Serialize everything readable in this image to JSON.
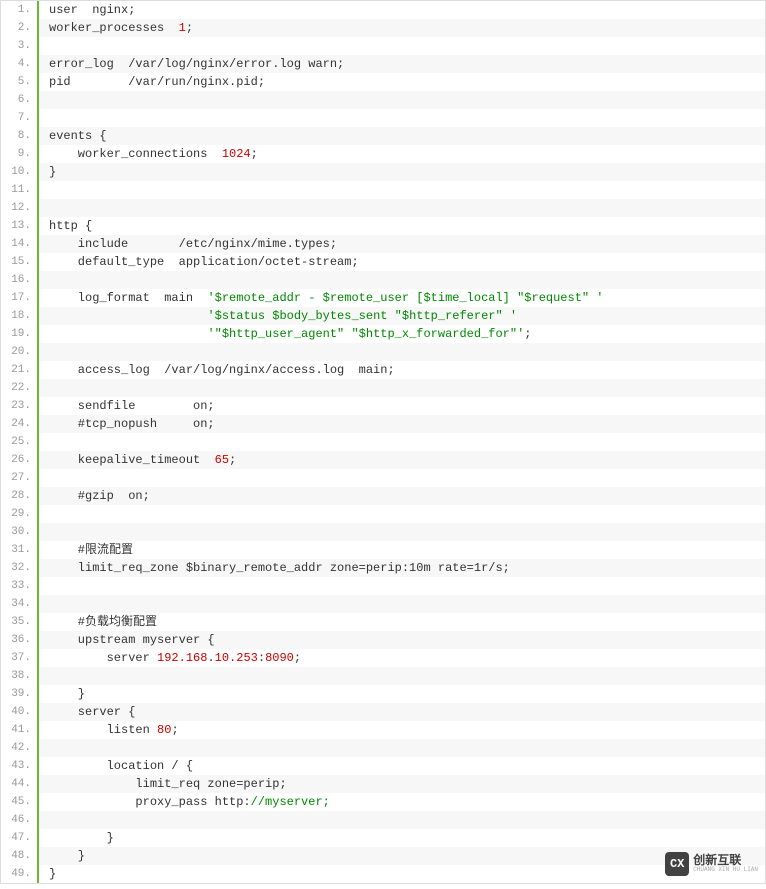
{
  "lines": [
    {
      "n": "1.",
      "segments": [
        {
          "t": "user  nginx;",
          "c": ""
        }
      ]
    },
    {
      "n": "2.",
      "segments": [
        {
          "t": "worker_processes  ",
          "c": ""
        },
        {
          "t": "1",
          "c": "num"
        },
        {
          "t": ";",
          "c": ""
        }
      ]
    },
    {
      "n": "3.",
      "segments": [
        {
          "t": "",
          "c": ""
        }
      ]
    },
    {
      "n": "4.",
      "segments": [
        {
          "t": "error_log  /var/log/nginx/error.log warn;",
          "c": ""
        }
      ]
    },
    {
      "n": "5.",
      "segments": [
        {
          "t": "pid        /var/run/nginx.pid;",
          "c": ""
        }
      ]
    },
    {
      "n": "6.",
      "segments": [
        {
          "t": "",
          "c": ""
        }
      ]
    },
    {
      "n": "7.",
      "segments": [
        {
          "t": "",
          "c": ""
        }
      ]
    },
    {
      "n": "8.",
      "segments": [
        {
          "t": "events {",
          "c": ""
        }
      ]
    },
    {
      "n": "9.",
      "segments": [
        {
          "t": "    worker_connections  ",
          "c": ""
        },
        {
          "t": "1024",
          "c": "num"
        },
        {
          "t": ";",
          "c": ""
        }
      ]
    },
    {
      "n": "10.",
      "segments": [
        {
          "t": "}",
          "c": ""
        }
      ]
    },
    {
      "n": "11.",
      "segments": [
        {
          "t": "",
          "c": ""
        }
      ]
    },
    {
      "n": "12.",
      "segments": [
        {
          "t": "",
          "c": ""
        }
      ]
    },
    {
      "n": "13.",
      "segments": [
        {
          "t": "http {",
          "c": ""
        }
      ]
    },
    {
      "n": "14.",
      "segments": [
        {
          "t": "    include       /etc/nginx/mime.types;",
          "c": ""
        }
      ]
    },
    {
      "n": "15.",
      "segments": [
        {
          "t": "    default_type  application/octet-stream;",
          "c": ""
        }
      ]
    },
    {
      "n": "16.",
      "segments": [
        {
          "t": "",
          "c": ""
        }
      ]
    },
    {
      "n": "17.",
      "segments": [
        {
          "t": "    log_format  main  ",
          "c": ""
        },
        {
          "t": "'$remote_addr - $remote_user [$time_local] \"$request\" '",
          "c": "str"
        }
      ]
    },
    {
      "n": "18.",
      "segments": [
        {
          "t": "                      ",
          "c": ""
        },
        {
          "t": "'$status $body_bytes_sent \"$http_referer\" '",
          "c": "str"
        }
      ]
    },
    {
      "n": "19.",
      "segments": [
        {
          "t": "                      ",
          "c": ""
        },
        {
          "t": "'\"$http_user_agent\" \"$http_x_forwarded_for\"'",
          "c": "str"
        },
        {
          "t": ";",
          "c": ""
        }
      ]
    },
    {
      "n": "20.",
      "segments": [
        {
          "t": "",
          "c": ""
        }
      ]
    },
    {
      "n": "21.",
      "segments": [
        {
          "t": "    access_log  /var/log/nginx/access.log  main;",
          "c": ""
        }
      ]
    },
    {
      "n": "22.",
      "segments": [
        {
          "t": "",
          "c": ""
        }
      ]
    },
    {
      "n": "23.",
      "segments": [
        {
          "t": "    sendfile        on;",
          "c": ""
        }
      ]
    },
    {
      "n": "24.",
      "segments": [
        {
          "t": "    #tcp_nopush     on;",
          "c": ""
        }
      ]
    },
    {
      "n": "25.",
      "segments": [
        {
          "t": "",
          "c": ""
        }
      ]
    },
    {
      "n": "26.",
      "segments": [
        {
          "t": "    keepalive_timeout  ",
          "c": ""
        },
        {
          "t": "65",
          "c": "num"
        },
        {
          "t": ";",
          "c": ""
        }
      ]
    },
    {
      "n": "27.",
      "segments": [
        {
          "t": "",
          "c": ""
        }
      ]
    },
    {
      "n": "28.",
      "segments": [
        {
          "t": "    #gzip  on;",
          "c": ""
        }
      ]
    },
    {
      "n": "29.",
      "segments": [
        {
          "t": "",
          "c": ""
        }
      ]
    },
    {
      "n": "30.",
      "segments": [
        {
          "t": "",
          "c": ""
        }
      ]
    },
    {
      "n": "31.",
      "segments": [
        {
          "t": "    #限流配置",
          "c": ""
        }
      ]
    },
    {
      "n": "32.",
      "segments": [
        {
          "t": "    limit_req_zone $binary_remote_addr zone=perip:10m rate=1r/s;",
          "c": ""
        }
      ]
    },
    {
      "n": "33.",
      "segments": [
        {
          "t": "",
          "c": ""
        }
      ]
    },
    {
      "n": "34.",
      "segments": [
        {
          "t": "",
          "c": ""
        }
      ]
    },
    {
      "n": "35.",
      "segments": [
        {
          "t": "    #负载均衡配置",
          "c": ""
        }
      ]
    },
    {
      "n": "36.",
      "segments": [
        {
          "t": "    upstream myserver {",
          "c": ""
        }
      ]
    },
    {
      "n": "37.",
      "segments": [
        {
          "t": "        server ",
          "c": ""
        },
        {
          "t": "192.168",
          "c": "num"
        },
        {
          "t": ".",
          "c": ""
        },
        {
          "t": "10.253",
          "c": "num"
        },
        {
          "t": ":",
          "c": ""
        },
        {
          "t": "8090",
          "c": "num"
        },
        {
          "t": ";",
          "c": ""
        }
      ]
    },
    {
      "n": "38.",
      "segments": [
        {
          "t": "",
          "c": ""
        }
      ]
    },
    {
      "n": "39.",
      "segments": [
        {
          "t": "    }",
          "c": ""
        }
      ]
    },
    {
      "n": "40.",
      "segments": [
        {
          "t": "    server {",
          "c": ""
        }
      ]
    },
    {
      "n": "41.",
      "segments": [
        {
          "t": "        listen ",
          "c": ""
        },
        {
          "t": "80",
          "c": "num"
        },
        {
          "t": ";",
          "c": ""
        }
      ]
    },
    {
      "n": "42.",
      "segments": [
        {
          "t": "",
          "c": ""
        }
      ]
    },
    {
      "n": "43.",
      "segments": [
        {
          "t": "        location / {",
          "c": ""
        }
      ]
    },
    {
      "n": "44.",
      "segments": [
        {
          "t": "            limit_req zone=perip;",
          "c": ""
        }
      ]
    },
    {
      "n": "45.",
      "segments": [
        {
          "t": "            proxy_pass http:",
          "c": ""
        },
        {
          "t": "//myserver;",
          "c": "str"
        }
      ]
    },
    {
      "n": "46.",
      "segments": [
        {
          "t": "",
          "c": ""
        }
      ]
    },
    {
      "n": "47.",
      "segments": [
        {
          "t": "        }",
          "c": ""
        }
      ]
    },
    {
      "n": "48.",
      "segments": [
        {
          "t": "    }",
          "c": ""
        }
      ]
    },
    {
      "n": "49.",
      "segments": [
        {
          "t": "}",
          "c": ""
        }
      ]
    }
  ],
  "watermark": {
    "icon": "CX",
    "text": "创新互联",
    "sub": "CHUANG XIN HU LIAN"
  }
}
